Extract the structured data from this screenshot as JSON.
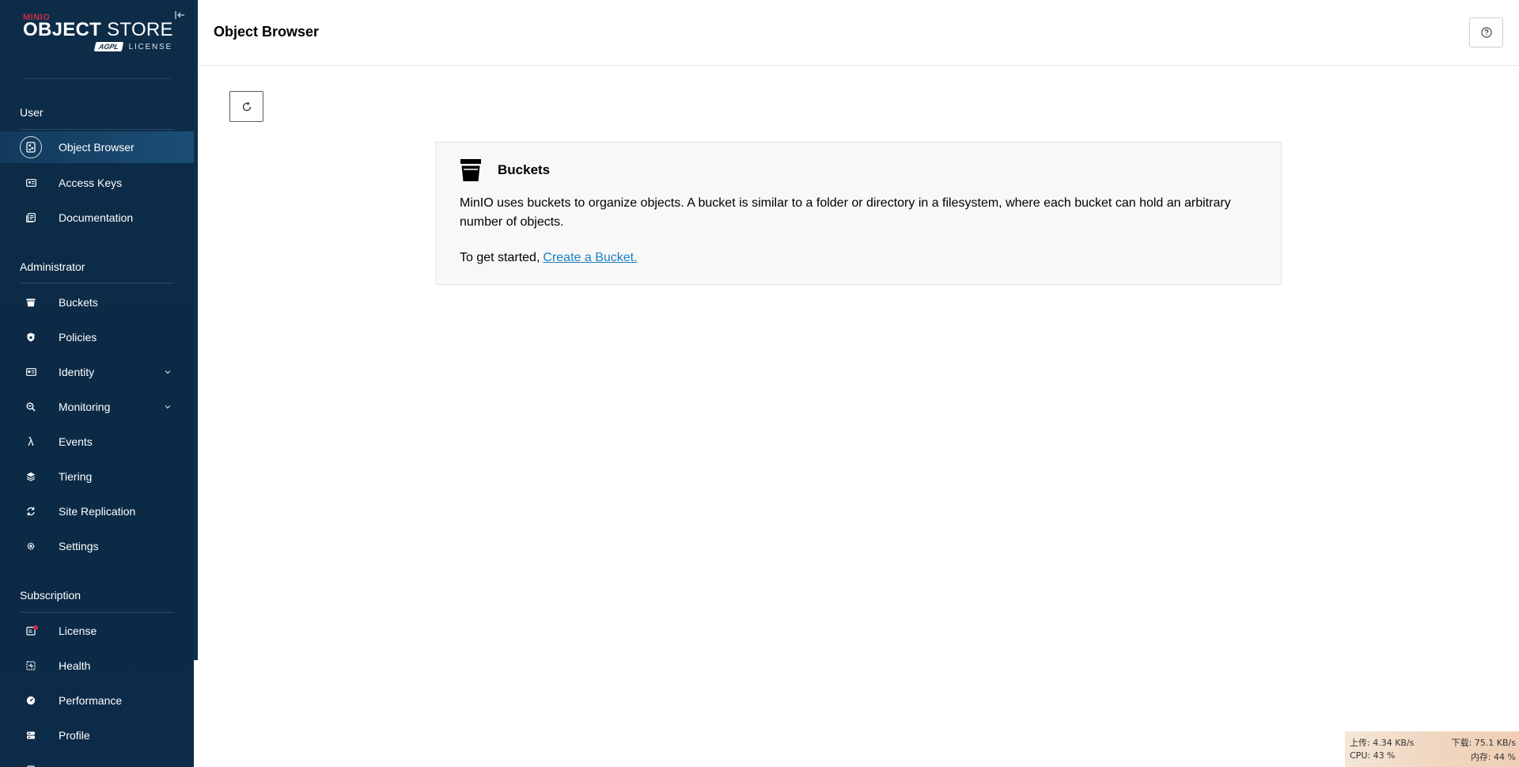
{
  "brand": {
    "company": "MINIO",
    "product_bold": "OBJECT",
    "product_light": "STORE",
    "license_badge": "AGPL",
    "license_label": "LICENSE"
  },
  "sidebar": {
    "sections": {
      "user": "User",
      "administrator": "Administrator",
      "subscription": "Subscription"
    },
    "user_items": [
      {
        "label": "Object Browser",
        "icon": "object-browser-icon",
        "active": true
      },
      {
        "label": "Access Keys",
        "icon": "access-keys-icon"
      },
      {
        "label": "Documentation",
        "icon": "documentation-icon"
      }
    ],
    "admin_items": [
      {
        "label": "Buckets",
        "icon": "bucket-icon"
      },
      {
        "label": "Policies",
        "icon": "policy-icon"
      },
      {
        "label": "Identity",
        "icon": "identity-icon",
        "expandable": true
      },
      {
        "label": "Monitoring",
        "icon": "monitoring-icon",
        "expandable": true
      },
      {
        "label": "Events",
        "icon": "lambda-icon"
      },
      {
        "label": "Tiering",
        "icon": "tiering-icon"
      },
      {
        "label": "Site Replication",
        "icon": "site-replication-icon"
      },
      {
        "label": "Settings",
        "icon": "gear-icon"
      }
    ],
    "subscription_items": [
      {
        "label": "License",
        "icon": "license-icon",
        "badge": true
      },
      {
        "label": "Health",
        "icon": "health-icon"
      },
      {
        "label": "Performance",
        "icon": "performance-icon"
      },
      {
        "label": "Profile",
        "icon": "profile-icon"
      }
    ]
  },
  "header": {
    "title": "Object Browser",
    "help_icon": "question-circle-icon"
  },
  "toolbar": {
    "refresh_icon": "refresh-icon"
  },
  "empty_state": {
    "title": "Buckets",
    "description": "MinIO uses buckets to organize objects. A bucket is similar to a folder or directory in a filesystem, where each bucket can hold an arbitrary number of objects.",
    "cta_prefix": "To get started,",
    "cta_link": "Create a Bucket."
  },
  "tray": {
    "upload": "上传: 4.34 KB/s",
    "download": "下载: 75.1 KB/s",
    "cpu": "CPU: 43 %",
    "memory": "内存: 44 %"
  },
  "colors": {
    "sidebar_bg": "#0d2c47",
    "active_item": "#1b4e76",
    "brand_red": "#c72e49",
    "link": "#1c7fc4"
  }
}
